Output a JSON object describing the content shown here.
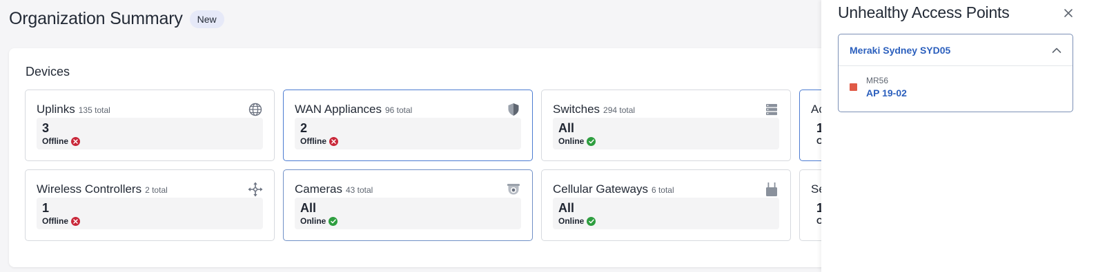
{
  "header": {
    "title": "Organization Summary",
    "badge": "New"
  },
  "devices": {
    "title": "Devices",
    "tiles": [
      {
        "name": "Uplinks",
        "total": "135 total",
        "value": "3",
        "status": "Offline",
        "status_type": "error",
        "icon": "globe-icon"
      },
      {
        "name": "WAN Appliances",
        "total": "96 total",
        "value": "2",
        "status": "Offline",
        "status_type": "error",
        "icon": "shield-icon"
      },
      {
        "name": "Switches",
        "total": "294 total",
        "value": "All",
        "status": "Online",
        "status_type": "ok",
        "icon": "switch-stack-icon"
      },
      {
        "name": "Ac",
        "total": "",
        "value": "1",
        "status": "O",
        "status_type": "partial",
        "icon": ""
      },
      {
        "name": "Wireless Controllers",
        "total": "2 total",
        "value": "1",
        "status": "Offline",
        "status_type": "error",
        "icon": "arrows-icon"
      },
      {
        "name": "Cameras",
        "total": "43 total",
        "value": "All",
        "status": "Online",
        "status_type": "ok",
        "icon": "camera-icon"
      },
      {
        "name": "Cellular Gateways",
        "total": "6 total",
        "value": "All",
        "status": "Online",
        "status_type": "ok",
        "icon": "gateway-icon"
      },
      {
        "name": "Se",
        "total": "",
        "value": "1",
        "status": "O",
        "status_type": "partial",
        "icon": ""
      }
    ]
  },
  "colors": {
    "error": "#c9283a",
    "ok": "#2e9e3f",
    "link": "#2b5fbd",
    "ap_unhealthy": "#e05a47"
  },
  "side_panel": {
    "title": "Unhealthy Access Points",
    "close_icon": "close-icon",
    "group": {
      "name": "Meraki Sydney SYD05",
      "expanded": true,
      "items": [
        {
          "model": "MR56",
          "name": "AP 19-02"
        }
      ]
    }
  }
}
